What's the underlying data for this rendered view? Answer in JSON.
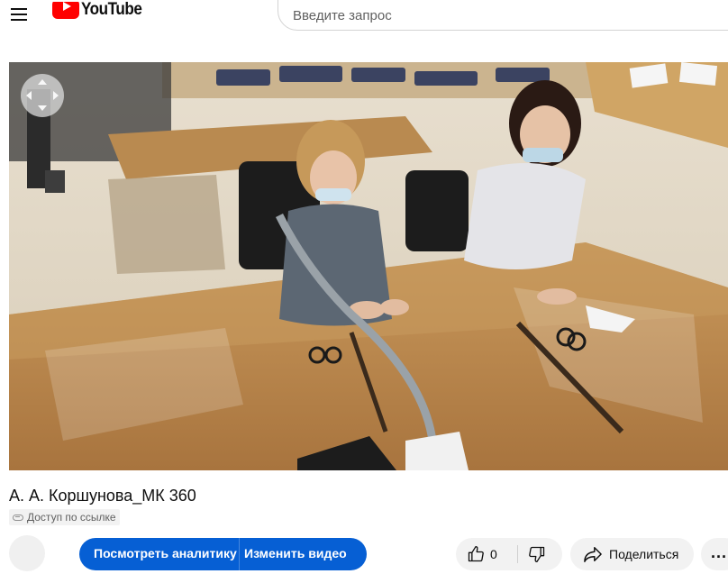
{
  "header": {
    "logo_text": "YouTube",
    "search_placeholder": "Введите запрос"
  },
  "video": {
    "title": "А. А. Коршунова_МК 360",
    "visibility": "Доступ по ссылке"
  },
  "actions": {
    "analytics_label": "Посмотреть аналитику",
    "edit_label": "Изменить видео",
    "like_count": "0",
    "share_label": "Поделиться",
    "more_label": "..."
  },
  "colors": {
    "accent_blue": "#065fd4",
    "brand_red": "#ff0000",
    "pill_gray": "#f2f2f2"
  },
  "icons": {
    "menu": "hamburger-menu-icon",
    "nav": "360-navigation-icon",
    "link": "link-icon",
    "like": "thumb-up-icon",
    "dislike": "thumb-down-icon",
    "share": "share-arrow-icon",
    "more": "more-horizontal-icon"
  }
}
